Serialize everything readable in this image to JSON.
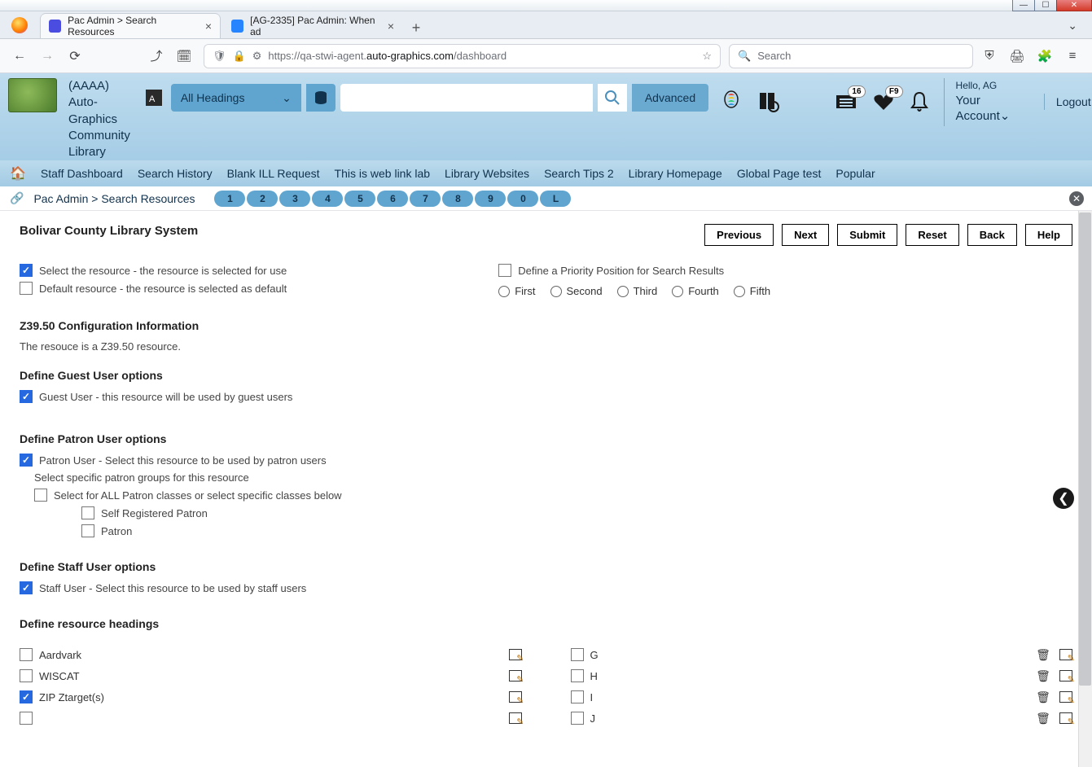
{
  "browser": {
    "tabs": [
      {
        "label": "Pac Admin > Search Resources",
        "active": true
      },
      {
        "label": "[AG-2335] Pac Admin: When ad",
        "active": false
      }
    ],
    "url_prefix": "https://",
    "url_host": "qa-stwi-agent.",
    "url_domain": "auto-graphics.com",
    "url_path": "/dashboard",
    "search_placeholder": "Search"
  },
  "header": {
    "library_name": "(AAAA) Auto-Graphics Community Library",
    "headings_select": "All Headings",
    "advanced": "Advanced",
    "list_badge": "16",
    "heart_badge": "F9",
    "greeting": "Hello, AG",
    "account_label": "Your Account",
    "logout": "Logout"
  },
  "nav": [
    "Staff Dashboard",
    "Search History",
    "Blank ILL Request",
    "This is web link lab",
    "Library Websites",
    "Search Tips 2",
    "Library Homepage",
    "Global Page test",
    "Popular"
  ],
  "breadcrumb": {
    "text": "Pac Admin > Search Resources",
    "pills": [
      "1",
      "2",
      "3",
      "4",
      "5",
      "6",
      "7",
      "8",
      "9",
      "0",
      "L"
    ]
  },
  "page": {
    "title": "Bolivar County Library System",
    "buttons": {
      "previous": "Previous",
      "next": "Next",
      "submit": "Submit",
      "reset": "Reset",
      "back": "Back",
      "help": "Help"
    },
    "select_resource": "Select the resource - the resource is selected for use",
    "default_resource": "Default resource - the resource is selected as default",
    "priority_position": "Define a Priority Position for Search Results",
    "priorities": [
      "First",
      "Second",
      "Third",
      "Fourth",
      "Fifth"
    ],
    "z3950_title": "Z39.50 Configuration Information",
    "z3950_text": "The resouce is a Z39.50 resource.",
    "guest_title": "Define Guest User options",
    "guest_check": "Guest User - this resource will be used by guest users",
    "patron_title": "Define Patron User options",
    "patron_check": "Patron User - Select this resource to be used by patron users",
    "patron_sub": "Select specific patron groups for this resource",
    "patron_all": "Select for ALL Patron classes or select specific classes below",
    "patron_classes": [
      "Self Registered Patron",
      "Patron"
    ],
    "staff_title": "Define Staff User options",
    "staff_check": "Staff User - Select this resource to be used by staff users",
    "headings_title": "Define resource headings",
    "headings_left": [
      {
        "label": "Aardvark",
        "checked": false
      },
      {
        "label": "WISCAT",
        "checked": false
      },
      {
        "label": "ZIP Ztarget(s)",
        "checked": true
      },
      {
        "label": "",
        "checked": false
      }
    ],
    "headings_right": [
      {
        "label": "G"
      },
      {
        "label": "H"
      },
      {
        "label": "I"
      },
      {
        "label": "J"
      }
    ]
  }
}
